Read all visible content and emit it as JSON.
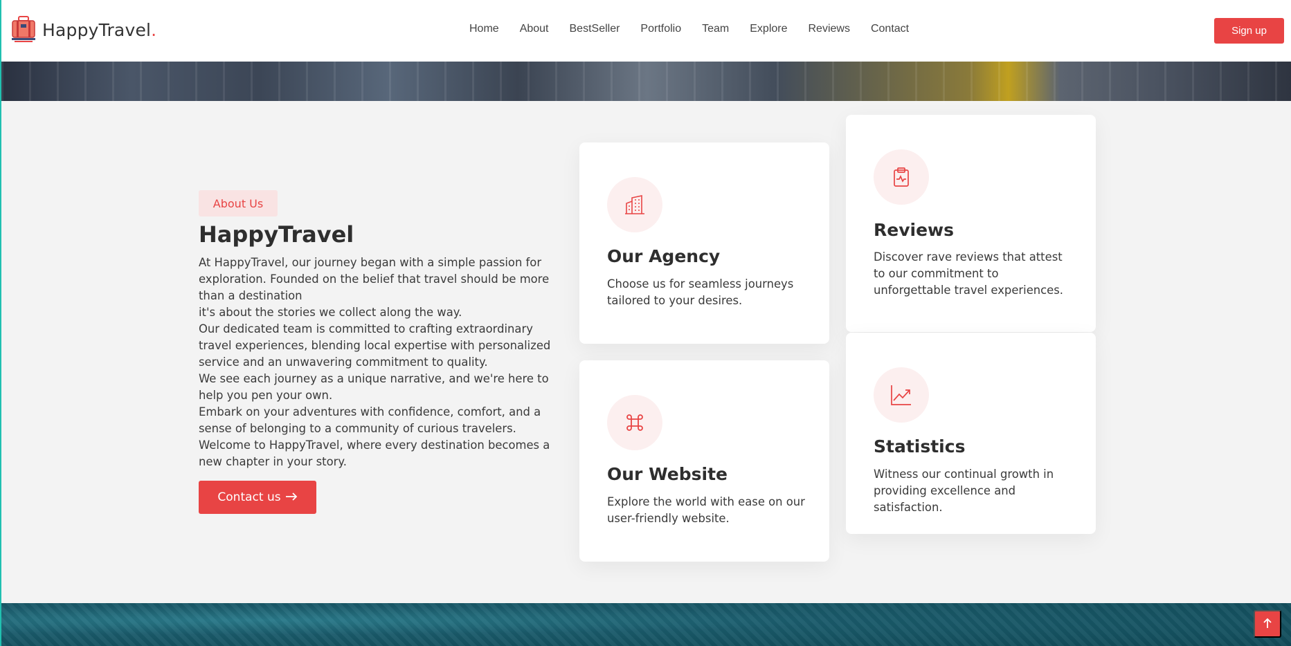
{
  "brand": {
    "name": "HappyTravel",
    "dot": "."
  },
  "nav": {
    "items": [
      "Home",
      "About",
      "BestSeller",
      "Portfolio",
      "Team",
      "Explore",
      "Reviews",
      "Contact"
    ],
    "signup_label": "Sign up"
  },
  "about": {
    "badge": "About Us",
    "title": "HappyTravel",
    "paragraphs": [
      "At HappyTravel, our journey began with a simple passion for exploration. Founded on the belief that travel should be more than a destination",
      "it's about the stories we collect along the way.",
      "Our dedicated team is committed to crafting extraordinary travel experiences, blending local expertise with personalized service and an unwavering commitment to quality.",
      "We see each journey as a unique narrative, and we're here to help you pen your own.",
      "Embark on your adventures with confidence, comfort, and a sense of belonging to a community of curious travelers.",
      "Welcome to HappyTravel, where every destination becomes a new chapter in your story."
    ],
    "contact_label": "Contact us"
  },
  "cards": {
    "agency": {
      "title": "Our Agency",
      "text": "Choose us for seamless journeys tailored to your desires.",
      "icon": "building-icon"
    },
    "website": {
      "title": "Our Website",
      "text": "Explore the world with ease on our user-friendly website.",
      "icon": "command-icon"
    },
    "reviews": {
      "title": "Reviews",
      "text": "Discover rave reviews that attest to our commitment to unforgettable travel experiences.",
      "icon": "clipboard-pulse-icon"
    },
    "stats": {
      "title": "Statistics",
      "text": "Witness our continual growth in providing excellence and satisfaction.",
      "icon": "graph-up-arrow-icon"
    }
  },
  "colors": {
    "accent": "#e84444",
    "accent_light": "#fcefef",
    "background": "#f3f3f3"
  }
}
